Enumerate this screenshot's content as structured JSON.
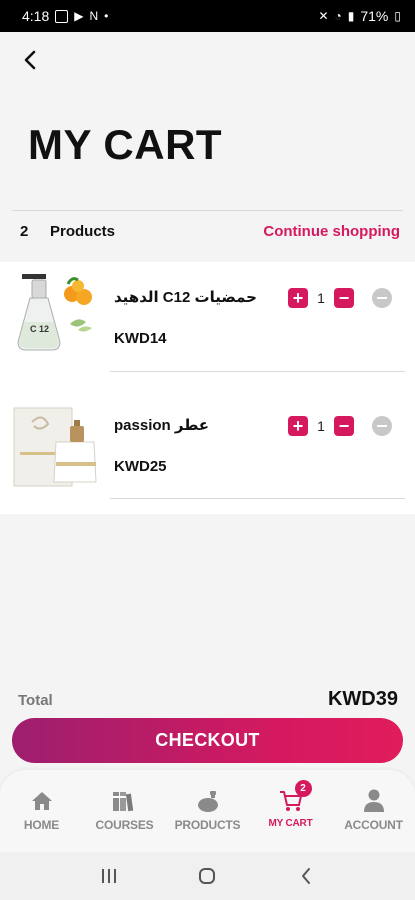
{
  "status_bar": {
    "time": "4:18",
    "battery": "71%"
  },
  "page": {
    "title": "MY CART"
  },
  "summary": {
    "count": "2",
    "label": "Products",
    "continue_label": "Continue shopping"
  },
  "items": [
    {
      "name": "الدهيد C12 حمضيات",
      "price": "KWD14",
      "quantity": "1"
    },
    {
      "name": "passion عطر",
      "price": "KWD25",
      "quantity": "1"
    }
  ],
  "qty_controls": {
    "plus": "+",
    "minus": "−"
  },
  "total": {
    "label": "Total",
    "value": "KWD39"
  },
  "checkout": {
    "label": "CHECKOUT"
  },
  "tabs": [
    {
      "label": "HOME",
      "icon": "home-icon"
    },
    {
      "label": "COURSES",
      "icon": "books-icon"
    },
    {
      "label": "PRODUCTS",
      "icon": "perfume-bottle-icon"
    },
    {
      "label": "MY CART",
      "icon": "cart-icon",
      "badge": "2",
      "active": true
    },
    {
      "label": "ACCOUNT",
      "icon": "user-icon"
    }
  ],
  "colors": {
    "accent": "#d6195f",
    "accent_dark": "#9c1f6e",
    "muted": "#8a8a8a",
    "remove": "#c8c8c8"
  }
}
